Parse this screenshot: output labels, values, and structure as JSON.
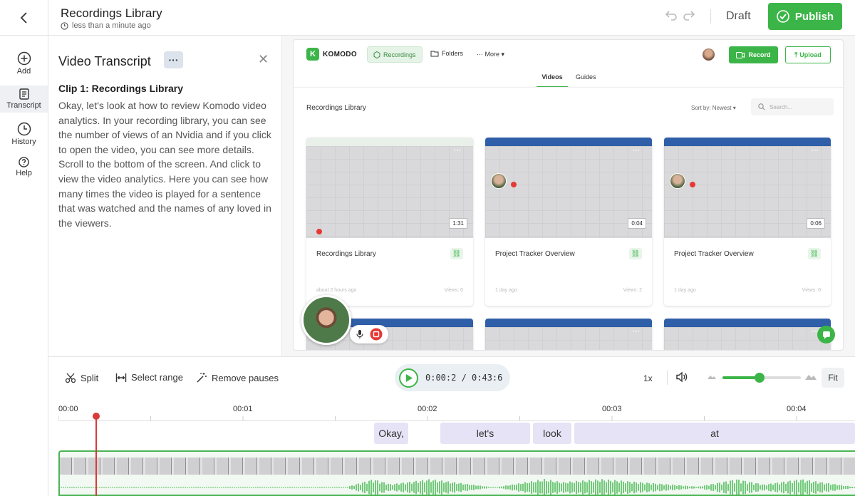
{
  "header": {
    "title": "Recordings Library",
    "subtitle": "less than a minute ago",
    "draft_label": "Draft",
    "publish_label": "Publish"
  },
  "rail": {
    "items": [
      {
        "label": "Add",
        "icon": "plus-circle-icon"
      },
      {
        "label": "Transcript",
        "icon": "document-icon"
      },
      {
        "label": "History",
        "icon": "clock-history-icon"
      },
      {
        "label": "Help",
        "icon": "question-icon"
      }
    ]
  },
  "transcript": {
    "title": "Video Transcript",
    "more_label": "···",
    "clip_title": "Clip 1: Recordings Library",
    "body": "Okay, let's look at how to review Komodo video analytics. In your recording library, you can see the number of views of an Nvidia and if you click to open the video, you can see more details. Scroll to the bottom of the screen. And click to view the video analytics. Here you can see how many times the video is played for a sentence that was watched and the names of any loved in the viewers."
  },
  "preview": {
    "brand": "KOMODO",
    "brand_letter": "K",
    "nav": {
      "recordings": "Recordings",
      "folders": "Folders",
      "more": "More"
    },
    "record_label": "Record",
    "upload_label": "Upload",
    "tabs": {
      "videos": "Videos",
      "guides": "Guides"
    },
    "library_title": "Recordings Library",
    "sort_label": "Sort by: Newest",
    "search_placeholder": "Search...",
    "cards": [
      {
        "name": "Recordings Library",
        "duration": "1:31",
        "meta": "about 2 hours ago",
        "views": "Views: 0"
      },
      {
        "name": "Project Tracker Overview",
        "duration": "0:04",
        "meta": "1 day ago",
        "views": "Views: 2"
      },
      {
        "name": "Project Tracker Overview",
        "duration": "0:06",
        "meta": "1 day ago",
        "views": "Views: 0"
      }
    ]
  },
  "toolbar": {
    "split_label": "Split",
    "select_range_label": "Select range",
    "remove_pauses_label": "Remove pauses",
    "timecode": "0:00:2 / 0:43:6",
    "speed_label": "1x",
    "zoom_level": 0.47,
    "fit_label": "Fit"
  },
  "timeline": {
    "ticks": [
      "00:00",
      "00:01",
      "00:02",
      "00:03",
      "00:04"
    ],
    "words": [
      "Okay,",
      "let's",
      "look",
      "at"
    ]
  },
  "colors": {
    "accent": "#3cb548",
    "playhead": "#d93a3a",
    "word_chip": "#e6e3f6"
  }
}
